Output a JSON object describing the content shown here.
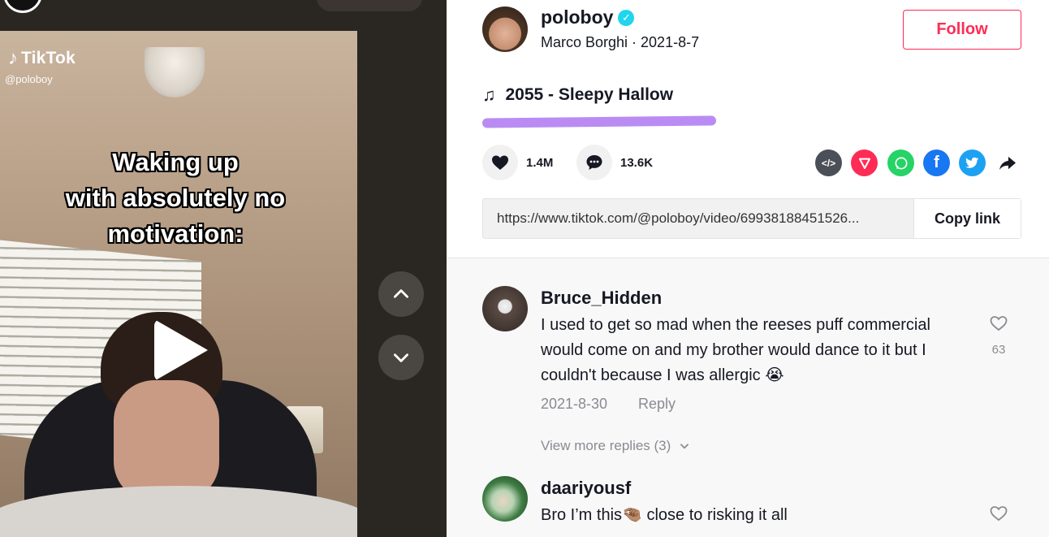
{
  "video": {
    "brand": "TikTok",
    "handle": "@poloboy",
    "caption_lines": [
      "Waking up",
      "with absolutely no",
      "motivation:"
    ],
    "play_icon": "play-icon",
    "nav_up_icon": "chevron-up-icon",
    "nav_down_icon": "chevron-down-icon"
  },
  "author": {
    "username": "poloboy",
    "verified": true,
    "meta": "Marco Borghi · 2021-8-7",
    "follow_label": "Follow"
  },
  "music": {
    "title": "2055 - Sleepy Hallow",
    "icon": "music-note-icon",
    "highlight_color": "#b37ff2"
  },
  "actions": {
    "likes": "1.4M",
    "comments": "13.6K"
  },
  "share": {
    "icons": [
      "embed-icon",
      "send-icon",
      "whatsapp-icon",
      "facebook-icon",
      "twitter-icon",
      "forward-icon"
    ]
  },
  "link": {
    "url": "https://www.tiktok.com/@poloboy/video/69938188451526...",
    "copy_label": "Copy link"
  },
  "comments": [
    {
      "username": "Bruce_Hidden",
      "text": "I used to get so mad when the reeses puff commercial would come on and my brother would dance to it but I couldn't because I was allergic 😭",
      "date": "2021-8-30",
      "reply_label": "Reply",
      "likes": "63",
      "view_more": "View more replies (3)"
    },
    {
      "username": "daariyousf",
      "text": "Bro I’m this🤏🏽 close to risking it all"
    }
  ],
  "colors": {
    "accent": "#fe2c55",
    "verified": "#20d5ec",
    "muted_text": "#8a8b91"
  }
}
